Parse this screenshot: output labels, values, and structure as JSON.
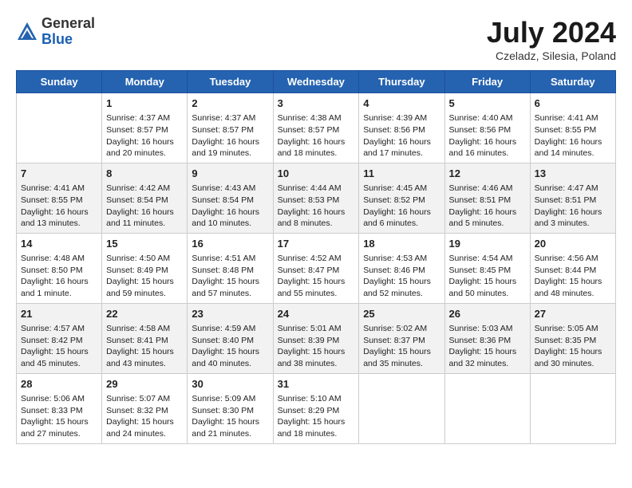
{
  "header": {
    "logo_general": "General",
    "logo_blue": "Blue",
    "month": "July 2024",
    "location": "Czeladz, Silesia, Poland"
  },
  "days_of_week": [
    "Sunday",
    "Monday",
    "Tuesday",
    "Wednesday",
    "Thursday",
    "Friday",
    "Saturday"
  ],
  "weeks": [
    [
      {
        "day": "",
        "info": ""
      },
      {
        "day": "1",
        "info": "Sunrise: 4:37 AM\nSunset: 8:57 PM\nDaylight: 16 hours\nand 20 minutes."
      },
      {
        "day": "2",
        "info": "Sunrise: 4:37 AM\nSunset: 8:57 PM\nDaylight: 16 hours\nand 19 minutes."
      },
      {
        "day": "3",
        "info": "Sunrise: 4:38 AM\nSunset: 8:57 PM\nDaylight: 16 hours\nand 18 minutes."
      },
      {
        "day": "4",
        "info": "Sunrise: 4:39 AM\nSunset: 8:56 PM\nDaylight: 16 hours\nand 17 minutes."
      },
      {
        "day": "5",
        "info": "Sunrise: 4:40 AM\nSunset: 8:56 PM\nDaylight: 16 hours\nand 16 minutes."
      },
      {
        "day": "6",
        "info": "Sunrise: 4:41 AM\nSunset: 8:55 PM\nDaylight: 16 hours\nand 14 minutes."
      }
    ],
    [
      {
        "day": "7",
        "info": "Sunrise: 4:41 AM\nSunset: 8:55 PM\nDaylight: 16 hours\nand 13 minutes."
      },
      {
        "day": "8",
        "info": "Sunrise: 4:42 AM\nSunset: 8:54 PM\nDaylight: 16 hours\nand 11 minutes."
      },
      {
        "day": "9",
        "info": "Sunrise: 4:43 AM\nSunset: 8:54 PM\nDaylight: 16 hours\nand 10 minutes."
      },
      {
        "day": "10",
        "info": "Sunrise: 4:44 AM\nSunset: 8:53 PM\nDaylight: 16 hours\nand 8 minutes."
      },
      {
        "day": "11",
        "info": "Sunrise: 4:45 AM\nSunset: 8:52 PM\nDaylight: 16 hours\nand 6 minutes."
      },
      {
        "day": "12",
        "info": "Sunrise: 4:46 AM\nSunset: 8:51 PM\nDaylight: 16 hours\nand 5 minutes."
      },
      {
        "day": "13",
        "info": "Sunrise: 4:47 AM\nSunset: 8:51 PM\nDaylight: 16 hours\nand 3 minutes."
      }
    ],
    [
      {
        "day": "14",
        "info": "Sunrise: 4:48 AM\nSunset: 8:50 PM\nDaylight: 16 hours\nand 1 minute."
      },
      {
        "day": "15",
        "info": "Sunrise: 4:50 AM\nSunset: 8:49 PM\nDaylight: 15 hours\nand 59 minutes."
      },
      {
        "day": "16",
        "info": "Sunrise: 4:51 AM\nSunset: 8:48 PM\nDaylight: 15 hours\nand 57 minutes."
      },
      {
        "day": "17",
        "info": "Sunrise: 4:52 AM\nSunset: 8:47 PM\nDaylight: 15 hours\nand 55 minutes."
      },
      {
        "day": "18",
        "info": "Sunrise: 4:53 AM\nSunset: 8:46 PM\nDaylight: 15 hours\nand 52 minutes."
      },
      {
        "day": "19",
        "info": "Sunrise: 4:54 AM\nSunset: 8:45 PM\nDaylight: 15 hours\nand 50 minutes."
      },
      {
        "day": "20",
        "info": "Sunrise: 4:56 AM\nSunset: 8:44 PM\nDaylight: 15 hours\nand 48 minutes."
      }
    ],
    [
      {
        "day": "21",
        "info": "Sunrise: 4:57 AM\nSunset: 8:42 PM\nDaylight: 15 hours\nand 45 minutes."
      },
      {
        "day": "22",
        "info": "Sunrise: 4:58 AM\nSunset: 8:41 PM\nDaylight: 15 hours\nand 43 minutes."
      },
      {
        "day": "23",
        "info": "Sunrise: 4:59 AM\nSunset: 8:40 PM\nDaylight: 15 hours\nand 40 minutes."
      },
      {
        "day": "24",
        "info": "Sunrise: 5:01 AM\nSunset: 8:39 PM\nDaylight: 15 hours\nand 38 minutes."
      },
      {
        "day": "25",
        "info": "Sunrise: 5:02 AM\nSunset: 8:37 PM\nDaylight: 15 hours\nand 35 minutes."
      },
      {
        "day": "26",
        "info": "Sunrise: 5:03 AM\nSunset: 8:36 PM\nDaylight: 15 hours\nand 32 minutes."
      },
      {
        "day": "27",
        "info": "Sunrise: 5:05 AM\nSunset: 8:35 PM\nDaylight: 15 hours\nand 30 minutes."
      }
    ],
    [
      {
        "day": "28",
        "info": "Sunrise: 5:06 AM\nSunset: 8:33 PM\nDaylight: 15 hours\nand 27 minutes."
      },
      {
        "day": "29",
        "info": "Sunrise: 5:07 AM\nSunset: 8:32 PM\nDaylight: 15 hours\nand 24 minutes."
      },
      {
        "day": "30",
        "info": "Sunrise: 5:09 AM\nSunset: 8:30 PM\nDaylight: 15 hours\nand 21 minutes."
      },
      {
        "day": "31",
        "info": "Sunrise: 5:10 AM\nSunset: 8:29 PM\nDaylight: 15 hours\nand 18 minutes."
      },
      {
        "day": "",
        "info": ""
      },
      {
        "day": "",
        "info": ""
      },
      {
        "day": "",
        "info": ""
      }
    ]
  ]
}
